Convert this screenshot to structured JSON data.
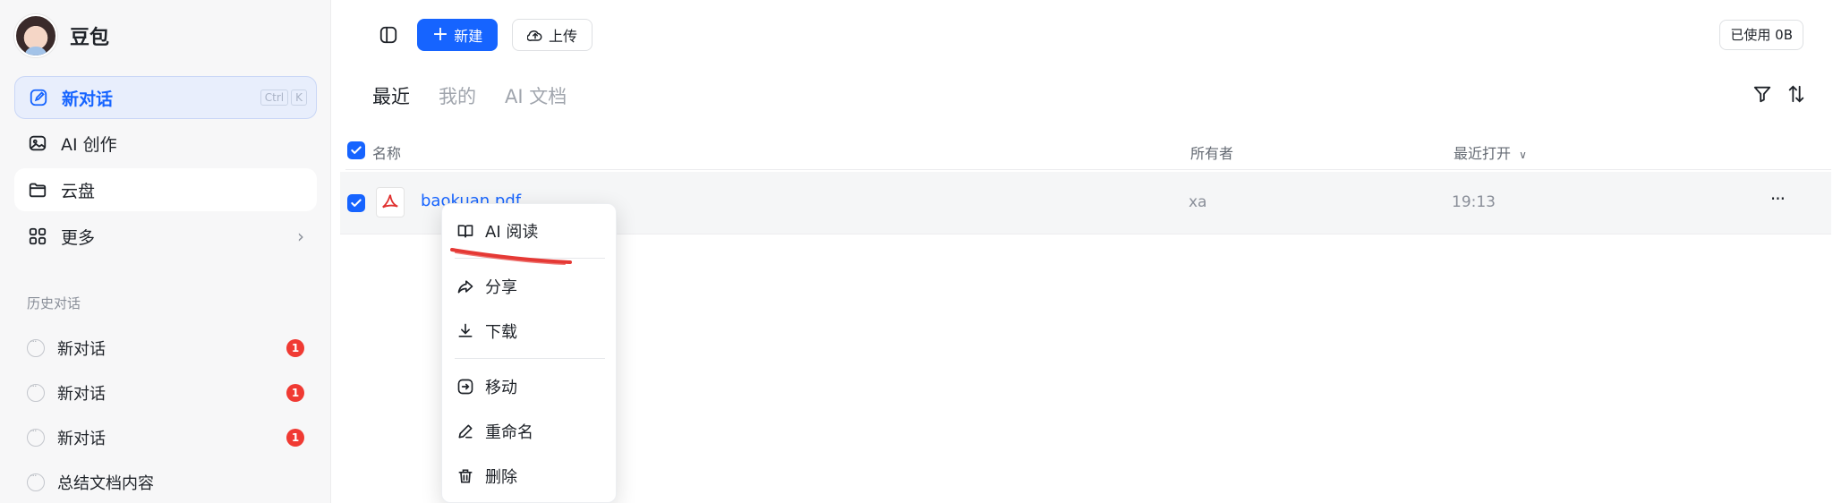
{
  "sidebar": {
    "brand": "豆包",
    "nav": [
      {
        "label": "新对话",
        "shortcut": [
          "Ctrl",
          "K"
        ]
      },
      {
        "label": "AI 创作"
      },
      {
        "label": "云盘"
      },
      {
        "label": "更多"
      }
    ],
    "history_title": "历史对话",
    "history": [
      {
        "label": "新对话",
        "badge": "1"
      },
      {
        "label": "新对话",
        "badge": "1"
      },
      {
        "label": "新对话",
        "badge": "1"
      },
      {
        "label": "总结文档内容"
      }
    ]
  },
  "toolbar": {
    "new_label": "新建",
    "upload_label": "上传",
    "usage": "已使用 0B"
  },
  "tabs": [
    "最近",
    "我的",
    "AI 文档"
  ],
  "table": {
    "headers": {
      "name": "名称",
      "owner": "所有者",
      "opened": "最近打开"
    },
    "rows": [
      {
        "name": "baokuan.pdf",
        "owner": "xa",
        "opened": "19:13"
      }
    ]
  },
  "context_menu": [
    "AI 阅读",
    "分享",
    "下载",
    "移动",
    "重命名",
    "删除"
  ],
  "colors": {
    "accent": "#1664ff",
    "badge": "#f03a33",
    "annotation": "#e53935"
  }
}
